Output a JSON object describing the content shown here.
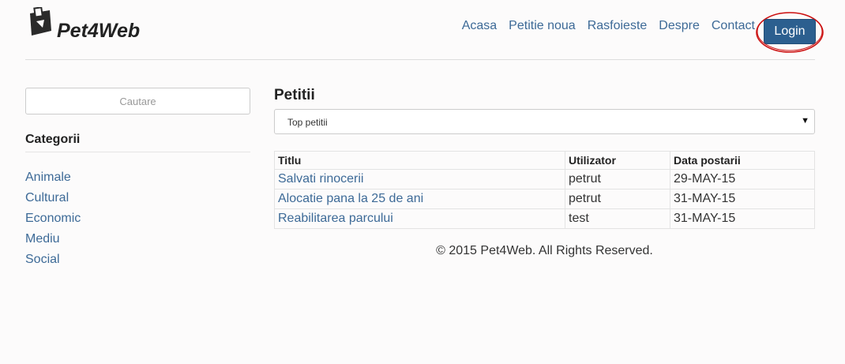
{
  "brand": {
    "name": "Pet4Web",
    "logo_icon": "petition-tag-icon"
  },
  "nav": {
    "items": [
      "Acasa",
      "Petitie noua",
      "Rasfoieste",
      "Despre",
      "Contact"
    ],
    "login_label": "Login",
    "highlight_color": "#cc1111"
  },
  "sidebar": {
    "search_placeholder": "Cautare",
    "categories_heading": "Categorii",
    "categories": [
      "Animale",
      "Cultural",
      "Economic",
      "Mediu",
      "Social"
    ]
  },
  "main": {
    "title": "Petitii",
    "sort_select": {
      "value": "Top petitii",
      "icon": "caret-down-icon"
    },
    "table": {
      "headers": [
        "Titlu",
        "Utilizator",
        "Data postarii"
      ],
      "rows": [
        [
          "Salvati rinocerii",
          "petrut",
          "29-MAY-15"
        ],
        [
          "Alocatie pana la 25 de ani",
          "petrut",
          "31-MAY-15"
        ],
        [
          "Reabilitarea parcului",
          "test",
          "31-MAY-15"
        ]
      ]
    }
  },
  "footer": {
    "text": "© 2015 Pet4Web. All Rights Reserved."
  },
  "colors": {
    "link": "#3d6a97",
    "button": "#2c5f8f",
    "background": "#fcfbfb"
  }
}
